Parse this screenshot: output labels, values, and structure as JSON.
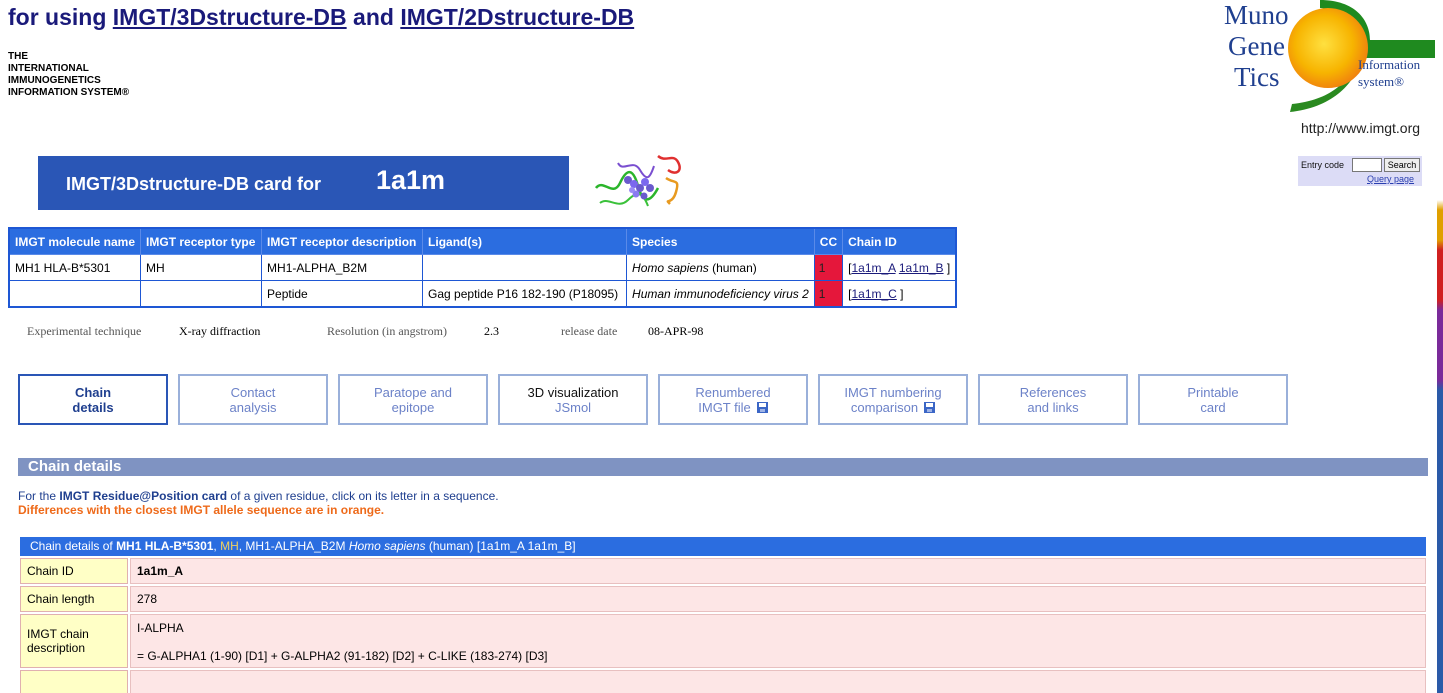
{
  "header": {
    "title_prefix": "for using ",
    "title_link1": "IMGT/3Dstructure-DB",
    "title_and": " and ",
    "title_link2": "IMGT/2Dstructure-DB",
    "org_lines": [
      "THE",
      "INTERNATIONAL",
      "IMMUNOGENETICS",
      "INFORMATION SYSTEM®"
    ],
    "logo": {
      "word1": "Muno",
      "word2": "Gene",
      "word3": "Tics",
      "info1": "Information",
      "info2": "system®"
    },
    "url": "http://www.imgt.org"
  },
  "search": {
    "label": "Entry code",
    "button": "Search",
    "query_link": "Query page"
  },
  "card": {
    "label": "IMGT/3Dstructure-DB card for",
    "code": "1a1m"
  },
  "summary": {
    "headers": [
      "IMGT molecule name",
      "IMGT receptor type",
      "IMGT receptor description",
      "Ligand(s)",
      "Species",
      "CC",
      "Chain ID"
    ],
    "rows": [
      {
        "molecule": "MH1 HLA-B*5301",
        "type": "MH",
        "description": "MH1-ALPHA_B2M",
        "ligand": "",
        "species_italic": "Homo sapiens",
        "species_rest": " (human)",
        "cc": "1",
        "chain_open": "[",
        "chain_a": "1a1m_A",
        "chain_b": "1a1m_B",
        "chain_close": "]"
      },
      {
        "molecule": "",
        "type": "",
        "description": "Peptide",
        "ligand": "Gag peptide P16 182-190 (P18095)",
        "species_italic": "Human immunodeficiency virus 2",
        "species_rest": "",
        "cc": "1",
        "chain_open": "[",
        "chain_a": "1a1m_C",
        "chain_close": "]"
      }
    ]
  },
  "technique": {
    "exp_label": "Experimental technique",
    "exp_value": "X-ray diffraction",
    "res_label": "Resolution (in angstrom)",
    "res_value": "2.3",
    "date_label": "release date",
    "date_value": "08-APR-98"
  },
  "tabs": [
    {
      "l1": "Chain",
      "l2": "details"
    },
    {
      "l1": "Contact",
      "l2": "analysis"
    },
    {
      "l1": "Paratope and",
      "l2": "epitope"
    },
    {
      "l1": "3D visualization",
      "l2": "JSmol"
    },
    {
      "l1": "Renumbered",
      "l2": "IMGT file"
    },
    {
      "l1": "IMGT numbering",
      "l2": "comparison"
    },
    {
      "l1": "References",
      "l2": "and links"
    },
    {
      "l1": "Printable",
      "l2": "card"
    }
  ],
  "section": {
    "title": "Chain details",
    "note_prefix": "For the ",
    "note_bold": "IMGT Residue@Position card",
    "note_suffix": " of a given residue, click on its letter in a sequence.",
    "note_orange": "Differences with the closest IMGT allele sequence are in orange."
  },
  "chain": {
    "head_prefix": "Chain details of ",
    "head_mol": "MH1 HLA-B*5301",
    "head_sep": ", ",
    "head_type": "MH",
    "head_desc": ", MH1-ALPHA_B2M ",
    "head_species": "Homo sapiens",
    "head_rest": " (human) [1a1m_A 1a1m_B]",
    "id_label": "Chain ID",
    "id_value": "1a1m_A",
    "length_label": "Chain length",
    "length_value": "278",
    "desc_label": "IMGT chain description",
    "desc_value1": "I-ALPHA",
    "desc_value2": "= G-ALPHA1 (1-90) [D1] + G-ALPHA2 (91-182) [D2] + C-LIKE (183-274) [D3]"
  }
}
